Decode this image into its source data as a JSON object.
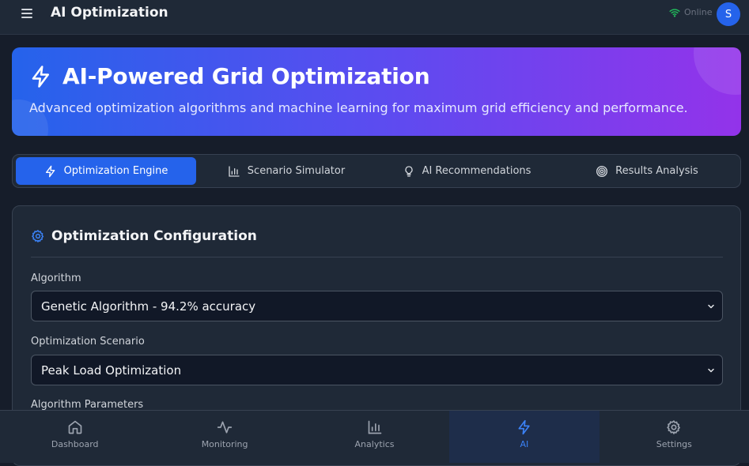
{
  "header": {
    "title": "AI Optimization",
    "status_text": "Online",
    "avatar_initial": "S",
    "menu_icon": "hamburger-icon",
    "status_icon": "wifi-icon",
    "status_color": "#22c55e"
  },
  "hero": {
    "title": "AI-Powered Grid Optimization",
    "subtitle": "Advanced optimization algorithms and machine learning for maximum grid efficiency and performance.",
    "icon": "lightning-icon"
  },
  "tabs": [
    {
      "label": "Optimization Engine",
      "icon": "lightning-icon",
      "active": true
    },
    {
      "label": "Scenario Simulator",
      "icon": "bar-chart-icon",
      "active": false
    },
    {
      "label": "AI Recommendations",
      "icon": "lightbulb-icon",
      "active": false
    },
    {
      "label": "Results Analysis",
      "icon": "target-icon",
      "active": false
    }
  ],
  "config": {
    "title": "Optimization Configuration",
    "icon": "gear-icon",
    "algorithm_label": "Algorithm",
    "algorithm_value": "Genetic Algorithm - 94.2% accuracy",
    "scenario_label": "Optimization Scenario",
    "scenario_value": "Peak Load Optimization",
    "params_label": "Algorithm Parameters"
  },
  "bottom_nav": [
    {
      "label": "Dashboard",
      "icon": "home-icon",
      "active": false
    },
    {
      "label": "Monitoring",
      "icon": "activity-icon",
      "active": false
    },
    {
      "label": "Analytics",
      "icon": "bar-chart-icon",
      "active": false
    },
    {
      "label": "AI",
      "icon": "lightning-icon",
      "active": true
    },
    {
      "label": "Settings",
      "icon": "gear-icon",
      "active": false
    }
  ],
  "colors": {
    "accent": "#2563eb",
    "gradient_start": "#2563eb",
    "gradient_end": "#9333ea",
    "background": "#161d2a",
    "panel": "#1f2937"
  }
}
